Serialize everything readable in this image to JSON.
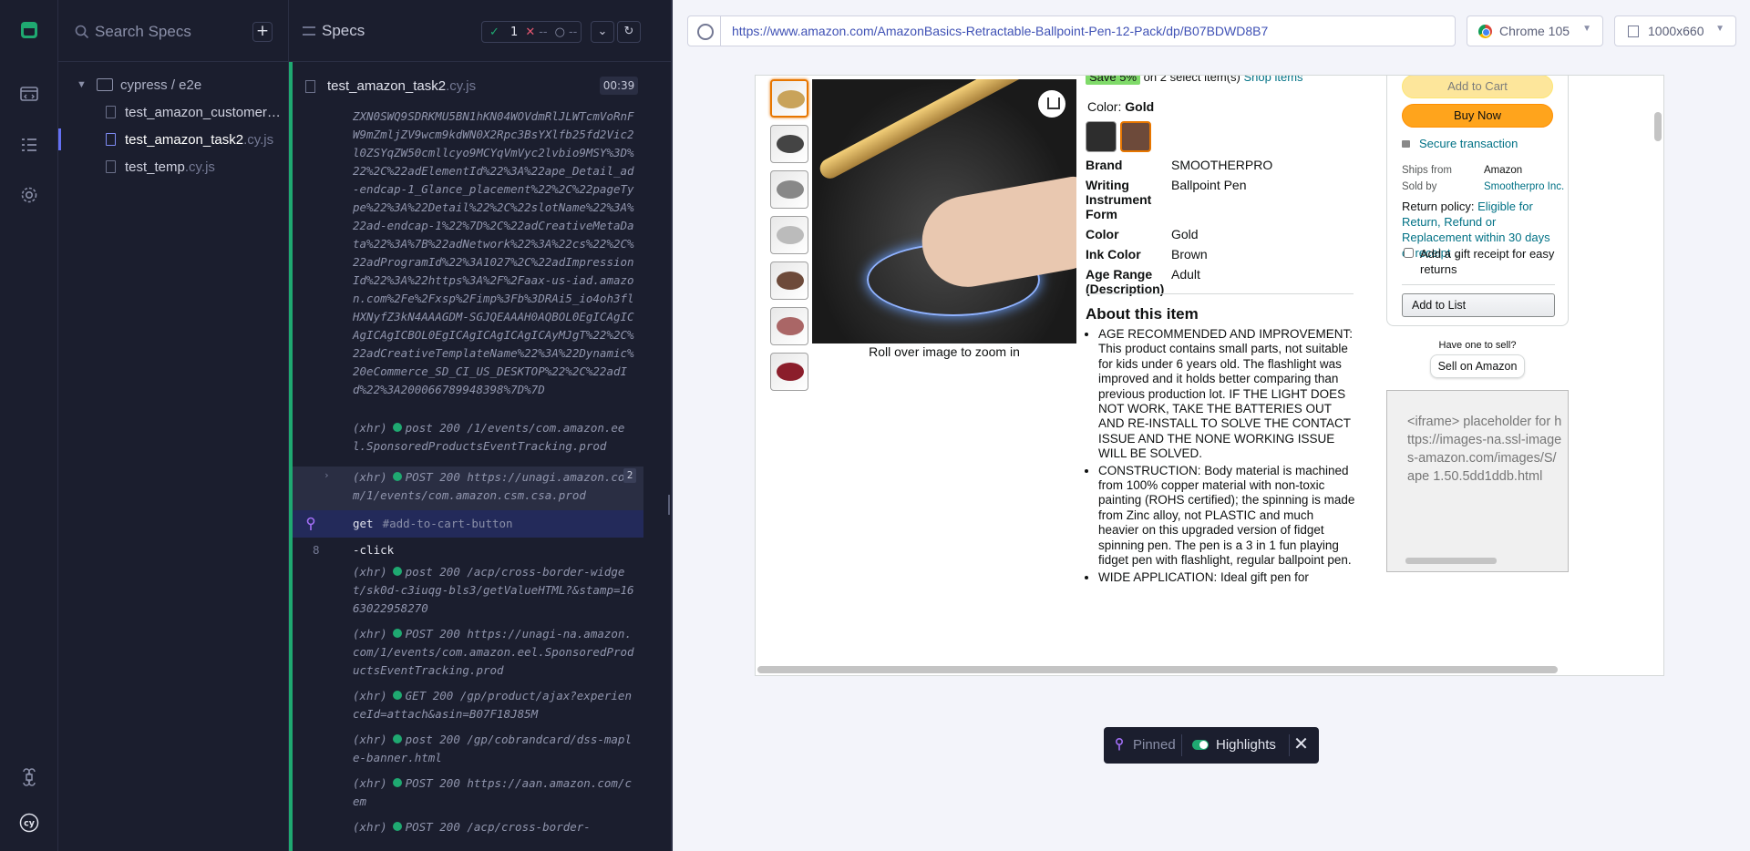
{
  "specs_panel": {
    "search_placeholder": "Search Specs",
    "add_label": "+",
    "folder": "cypress / e2e",
    "files": [
      {
        "name": "test_amazon_customer_",
        "ext": "…"
      },
      {
        "name": "test_amazon_task2",
        "ext": ".cy.js"
      },
      {
        "name": "test_temp",
        "ext": ".cy.js"
      }
    ]
  },
  "reporter": {
    "title": "Specs",
    "passed": "1",
    "failed": "--",
    "pending": "--",
    "spec_name": "test_amazon_task2",
    "spec_ext": ".cy.js",
    "duration": "00:39",
    "log_url_block": "ZXN0SWQ9SDRKMU5BN1hKN04WOVdmRlJLWTcmVoRnFW9mZmljZV9wcm9kdWN0X2Rpc3BsYXlfb25fd2Vic2l0ZSYqZW50cmllcyo9MCYqVmVyc2lvbio9MSY%3D%22%2C%22adElementId%22%3A%22ape_Detail_ad-endcap-1_Glance_placement%22%2C%22pageType%22%3A%22Detail%22%2C%22slotName%22%3A%22ad-endcap-1%22%7D%2C%22adCreativeMetaData%22%3A%7B%22adNetwork%22%3A%22cs%22%2C%22adProgramId%22%3A1027%2C%22adImpressionId%22%3A%22https%3A%2F%2Faax-us-iad.amazon.com%2Fe%2Fxsp%2Fimp%3Fb%3DRAi5_io4oh3flHXNyfZ3kN4AAAGDM-SGJQEAAAH0AQBOL0EgICAgICAgICAgICBOL0EgICAgICAgICAgICAyMJgT%22%2C%22adCreativeTemplateName%22%3A%22Dynamic%20eCommerce_SD_CI_US_DESKTOP%22%2C%22adId%22%3A200066789948398%7D%7D",
    "log1": "(xhr)",
    "log1_text": "post 200 /1/events/com.amazon.eel.SponsoredProductsEventTracking.prod",
    "log2": "(xhr)",
    "log2_text": "POST 200 https://unagi.amazon.com/1/events/com.amazon.csm.csa.prod",
    "log2_count": "2",
    "cmd_get": "get",
    "cmd_get_selector": "#add-to-cart-button",
    "cmd_num": "8",
    "cmd_click": "-click",
    "log3_text": "post 200 /acp/cross-border-widget/sk0d-c3iuqg-bls3/getValueHTML?&stamp=1663022958270",
    "log4_text": "POST 200 https://unagi-na.amazon.com/1/events/com.amazon.eel.SponsoredProductsEventTracking.prod",
    "log5_text": "GET 200 /gp/product/ajax?experienceId=attach&asin=B07F18J85M",
    "log6_text": "post 200 /gp/cobrandcard/dss-maple-banner.html",
    "log7_text": "POST 200 https://aan.amazon.com/cem",
    "log8_text": "POST 200 /acp/cross-border-"
  },
  "toolbar": {
    "url": "https://www.amazon.com/AmazonBasics-Retractable-Ballpoint-Pen-12-Pack/dp/B07BDWD8B7",
    "browser": "Chrome 105",
    "viewport": "1000x660"
  },
  "product": {
    "save_tag": "Save 5%",
    "save_text": "on 2 select item(s)",
    "shop_items": "Shop items",
    "color_label": "Color:",
    "color_value": "Gold",
    "zoom_hint": "Roll over image to zoom in",
    "specs": [
      {
        "k": "Brand",
        "v": "SMOOTHERPRO"
      },
      {
        "k": "Writing Instrument Form",
        "v": "Ballpoint Pen"
      },
      {
        "k": "Color",
        "v": "Gold"
      },
      {
        "k": "Ink Color",
        "v": "Brown"
      },
      {
        "k": "Age Range (Description)",
        "v": "Adult"
      }
    ],
    "about_title": "About this item",
    "bullets": [
      "AGE RECOMMENDED AND IMPROVEMENT: This product contains small parts, not suitable for kids under 6 years old. The flashlight was improved and it holds better comparing than previous production lot. IF THE LIGHT DOES NOT WORK, TAKE THE BATTERIES OUT AND RE-INSTALL TO SOLVE THE CONTACT ISSUE AND THE NONE WORKING ISSUE WILL BE SOLVED.",
      "CONSTRUCTION: Body material is machined from 100% copper material with non-toxic painting (ROHS certified); the spinning is made from Zinc alloy, not PLASTIC and much heavier on this upgraded version of fidget spinning pen. The pen is a 3 in 1 fun playing fidget pen with flashlight, regular ballpoint pen.",
      "WIDE APPLICATION: Ideal gift pen for"
    ]
  },
  "buybox": {
    "add_to_cart": "Add to Cart",
    "buy_now": "Buy Now",
    "secure": "Secure transaction",
    "ships_from_label": "Ships from",
    "ships_from": "Amazon",
    "sold_by_label": "Sold by",
    "sold_by": "Smootherpro Inc.",
    "return_label": "Return policy:",
    "return_link": "Eligible for Return, Refund or Replacement within 30 days of receipt",
    "gift": "Add a gift receipt for easy returns",
    "add_to_list": "Add to List",
    "have_one": "Have one to sell?",
    "sell": "Sell on Amazon",
    "iframe_text": "<iframe> placeholder for https://images-na.ssl-images-amazon.com/images/S/ape 1.50.5dd1ddb.html"
  },
  "pinbar": {
    "pinned": "Pinned",
    "highlights": "Highlights",
    "close": "✕"
  },
  "colors": {
    "accent": "#6470f3",
    "pass": "#1fa971",
    "fail": "#e45770"
  }
}
